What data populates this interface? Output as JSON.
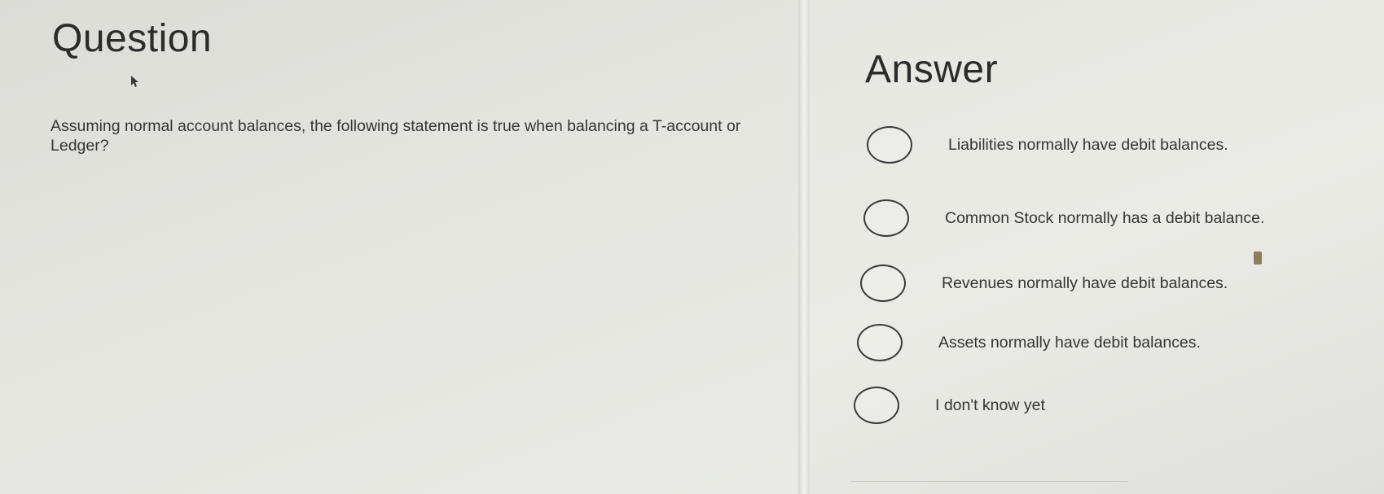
{
  "question": {
    "title": "Question",
    "text": "Assuming normal account balances, the following statement is true when balancing a T-account or Ledger?"
  },
  "answer": {
    "title": "Answer",
    "options": [
      {
        "label": "Liabilities normally have debit balances."
      },
      {
        "label": "Common Stock normally has a debit balance."
      },
      {
        "label": "Revenues normally have debit balances."
      },
      {
        "label": "Assets normally have debit balances."
      },
      {
        "label": "I don't know yet"
      }
    ]
  },
  "colors": {
    "text": "#2e2e2e",
    "radio_border": "#3a3a3a",
    "background": "#e5e5e0"
  },
  "icons": [
    "mouse-pointer-icon",
    "bookmark-icon",
    "radio-unchecked-icon"
  ]
}
